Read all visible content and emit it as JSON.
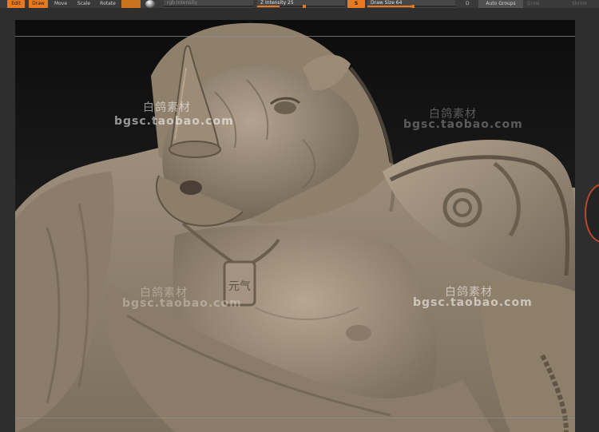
{
  "toolbar": {
    "edit_label": "Edit",
    "draw_label": "Draw",
    "move_label": "Move",
    "scale_label": "Scale",
    "rotate_label": "Rotate",
    "rgb_intensity_label": "rgb Intensity",
    "z_intensity_label": "Z Intensity 25",
    "z_intensity_value": 25,
    "s_label": "S",
    "draw_size_label": "Draw Size 64",
    "draw_size_value": 64,
    "d_label": "D",
    "auto_groups_label": "Auto Groups",
    "grow_label": "Grow",
    "shrink_label": "Shrink",
    "accent_color": "#e8791e"
  },
  "watermarks": {
    "cn_text": "白鸽素材",
    "en_text": "bgsc.taobao.com"
  },
  "model": {
    "subject": "sculpted rhino warrior bust",
    "pendant_glyphs": "元气"
  }
}
